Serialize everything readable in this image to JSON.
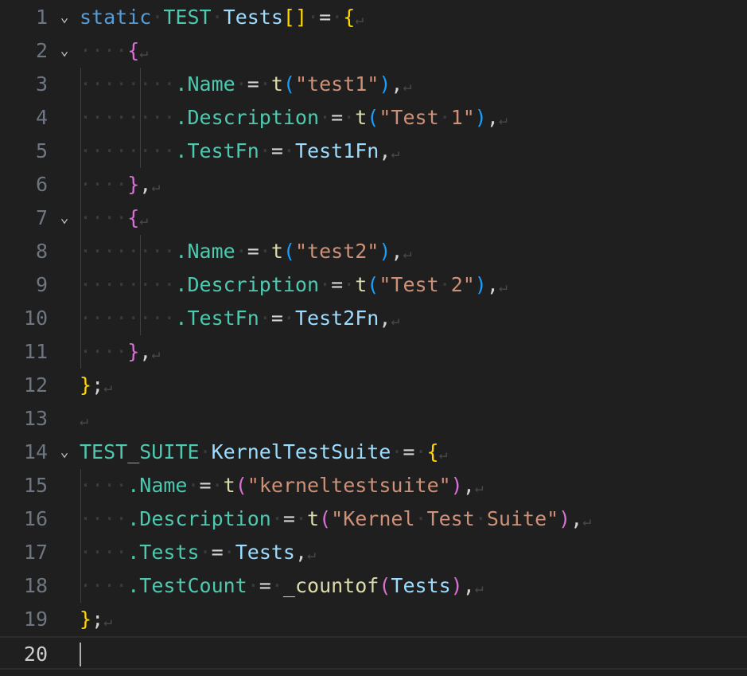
{
  "editor": {
    "whitespace_glyph": "·",
    "eol_glyph": "↵",
    "fold_glyph": "⌄",
    "active_line": 20,
    "lines": [
      {
        "n": "1",
        "indent": 0,
        "fold": true,
        "eol": true,
        "tokens": [
          {
            "t": "static",
            "c": "kw"
          },
          {
            "t": " ",
            "c": "ws"
          },
          {
            "t": "TEST",
            "c": "ty"
          },
          {
            "t": " ",
            "c": "ws"
          },
          {
            "t": "Tests",
            "c": "var"
          },
          {
            "t": "[]",
            "c": "b1"
          },
          {
            "t": " ",
            "c": "ws"
          },
          {
            "t": "=",
            "c": "op"
          },
          {
            "t": " ",
            "c": "ws"
          },
          {
            "t": "{",
            "c": "b1"
          }
        ]
      },
      {
        "n": "2",
        "indent": 4,
        "fold": true,
        "eol": true,
        "tokens": [
          {
            "t": "{",
            "c": "b2"
          }
        ]
      },
      {
        "n": "3",
        "indent": 8,
        "fold": false,
        "eol": true,
        "tokens": [
          {
            "t": ".Name",
            "c": "ty"
          },
          {
            "t": " ",
            "c": "ws"
          },
          {
            "t": "=",
            "c": "op"
          },
          {
            "t": " ",
            "c": "ws"
          },
          {
            "t": "t",
            "c": "fn"
          },
          {
            "t": "(",
            "c": "b3"
          },
          {
            "t": "\"test1\"",
            "c": "str"
          },
          {
            "t": ")",
            "c": "b3"
          },
          {
            "t": ",",
            "c": "punc"
          }
        ]
      },
      {
        "n": "4",
        "indent": 8,
        "fold": false,
        "eol": true,
        "tokens": [
          {
            "t": ".Description",
            "c": "ty"
          },
          {
            "t": " ",
            "c": "ws"
          },
          {
            "t": "=",
            "c": "op"
          },
          {
            "t": " ",
            "c": "ws"
          },
          {
            "t": "t",
            "c": "fn"
          },
          {
            "t": "(",
            "c": "b3"
          },
          {
            "t": "\"Test",
            "c": "str"
          },
          {
            "t": " ",
            "c": "ws"
          },
          {
            "t": "1\"",
            "c": "str"
          },
          {
            "t": ")",
            "c": "b3"
          },
          {
            "t": ",",
            "c": "punc"
          }
        ]
      },
      {
        "n": "5",
        "indent": 8,
        "fold": false,
        "eol": true,
        "tokens": [
          {
            "t": ".TestFn",
            "c": "ty"
          },
          {
            "t": " ",
            "c": "ws"
          },
          {
            "t": "=",
            "c": "op"
          },
          {
            "t": " ",
            "c": "ws"
          },
          {
            "t": "Test1Fn",
            "c": "var"
          },
          {
            "t": ",",
            "c": "punc"
          }
        ]
      },
      {
        "n": "6",
        "indent": 4,
        "fold": false,
        "eol": true,
        "tokens": [
          {
            "t": "}",
            "c": "b2"
          },
          {
            "t": ",",
            "c": "punc"
          }
        ]
      },
      {
        "n": "7",
        "indent": 4,
        "fold": true,
        "eol": true,
        "tokens": [
          {
            "t": "{",
            "c": "b2"
          }
        ]
      },
      {
        "n": "8",
        "indent": 8,
        "fold": false,
        "eol": true,
        "tokens": [
          {
            "t": ".Name",
            "c": "ty"
          },
          {
            "t": " ",
            "c": "ws"
          },
          {
            "t": "=",
            "c": "op"
          },
          {
            "t": " ",
            "c": "ws"
          },
          {
            "t": "t",
            "c": "fn"
          },
          {
            "t": "(",
            "c": "b3"
          },
          {
            "t": "\"test2\"",
            "c": "str"
          },
          {
            "t": ")",
            "c": "b3"
          },
          {
            "t": ",",
            "c": "punc"
          }
        ]
      },
      {
        "n": "9",
        "indent": 8,
        "fold": false,
        "eol": true,
        "tokens": [
          {
            "t": ".Description",
            "c": "ty"
          },
          {
            "t": " ",
            "c": "ws"
          },
          {
            "t": "=",
            "c": "op"
          },
          {
            "t": " ",
            "c": "ws"
          },
          {
            "t": "t",
            "c": "fn"
          },
          {
            "t": "(",
            "c": "b3"
          },
          {
            "t": "\"Test",
            "c": "str"
          },
          {
            "t": " ",
            "c": "ws"
          },
          {
            "t": "2\"",
            "c": "str"
          },
          {
            "t": ")",
            "c": "b3"
          },
          {
            "t": ",",
            "c": "punc"
          }
        ]
      },
      {
        "n": "10",
        "indent": 8,
        "fold": false,
        "eol": true,
        "tokens": [
          {
            "t": ".TestFn",
            "c": "ty"
          },
          {
            "t": " ",
            "c": "ws"
          },
          {
            "t": "=",
            "c": "op"
          },
          {
            "t": " ",
            "c": "ws"
          },
          {
            "t": "Test2Fn",
            "c": "var"
          },
          {
            "t": ",",
            "c": "punc"
          }
        ]
      },
      {
        "n": "11",
        "indent": 4,
        "fold": false,
        "eol": true,
        "tokens": [
          {
            "t": "}",
            "c": "b2"
          },
          {
            "t": ",",
            "c": "punc"
          }
        ]
      },
      {
        "n": "12",
        "indent": 0,
        "fold": false,
        "eol": true,
        "tokens": [
          {
            "t": "}",
            "c": "b1"
          },
          {
            "t": ";",
            "c": "punc"
          }
        ]
      },
      {
        "n": "13",
        "indent": 0,
        "fold": false,
        "eol": true,
        "tokens": []
      },
      {
        "n": "14",
        "indent": 0,
        "fold": true,
        "eol": true,
        "tokens": [
          {
            "t": "TEST_SUITE",
            "c": "ty"
          },
          {
            "t": " ",
            "c": "ws"
          },
          {
            "t": "KernelTestSuite",
            "c": "var"
          },
          {
            "t": " ",
            "c": "ws"
          },
          {
            "t": "=",
            "c": "op"
          },
          {
            "t": " ",
            "c": "ws"
          },
          {
            "t": "{",
            "c": "b1"
          }
        ]
      },
      {
        "n": "15",
        "indent": 4,
        "fold": false,
        "eol": true,
        "tokens": [
          {
            "t": ".Name",
            "c": "ty"
          },
          {
            "t": " ",
            "c": "ws"
          },
          {
            "t": "=",
            "c": "op"
          },
          {
            "t": " ",
            "c": "ws"
          },
          {
            "t": "t",
            "c": "fn"
          },
          {
            "t": "(",
            "c": "b2"
          },
          {
            "t": "\"kerneltestsuite\"",
            "c": "str"
          },
          {
            "t": ")",
            "c": "b2"
          },
          {
            "t": ",",
            "c": "punc"
          }
        ]
      },
      {
        "n": "16",
        "indent": 4,
        "fold": false,
        "eol": true,
        "tokens": [
          {
            "t": ".Description",
            "c": "ty"
          },
          {
            "t": " ",
            "c": "ws"
          },
          {
            "t": "=",
            "c": "op"
          },
          {
            "t": " ",
            "c": "ws"
          },
          {
            "t": "t",
            "c": "fn"
          },
          {
            "t": "(",
            "c": "b2"
          },
          {
            "t": "\"Kernel",
            "c": "str"
          },
          {
            "t": " ",
            "c": "ws"
          },
          {
            "t": "Test",
            "c": "str"
          },
          {
            "t": " ",
            "c": "ws"
          },
          {
            "t": "Suite\"",
            "c": "str"
          },
          {
            "t": ")",
            "c": "b2"
          },
          {
            "t": ",",
            "c": "punc"
          }
        ]
      },
      {
        "n": "17",
        "indent": 4,
        "fold": false,
        "eol": true,
        "tokens": [
          {
            "t": ".Tests",
            "c": "ty"
          },
          {
            "t": " ",
            "c": "ws"
          },
          {
            "t": "=",
            "c": "op"
          },
          {
            "t": " ",
            "c": "ws"
          },
          {
            "t": "Tests",
            "c": "var"
          },
          {
            "t": ",",
            "c": "punc"
          }
        ]
      },
      {
        "n": "18",
        "indent": 4,
        "fold": false,
        "eol": true,
        "tokens": [
          {
            "t": ".TestCount",
            "c": "ty"
          },
          {
            "t": " ",
            "c": "ws"
          },
          {
            "t": "=",
            "c": "op"
          },
          {
            "t": " ",
            "c": "ws"
          },
          {
            "t": "_countof",
            "c": "fn"
          },
          {
            "t": "(",
            "c": "b2"
          },
          {
            "t": "Tests",
            "c": "var"
          },
          {
            "t": ")",
            "c": "b2"
          },
          {
            "t": ",",
            "c": "punc"
          }
        ]
      },
      {
        "n": "19",
        "indent": 0,
        "fold": false,
        "eol": true,
        "tokens": [
          {
            "t": "}",
            "c": "b1"
          },
          {
            "t": ";",
            "c": "punc"
          }
        ]
      },
      {
        "n": "20",
        "indent": 0,
        "fold": false,
        "eol": false,
        "tokens": []
      }
    ]
  }
}
